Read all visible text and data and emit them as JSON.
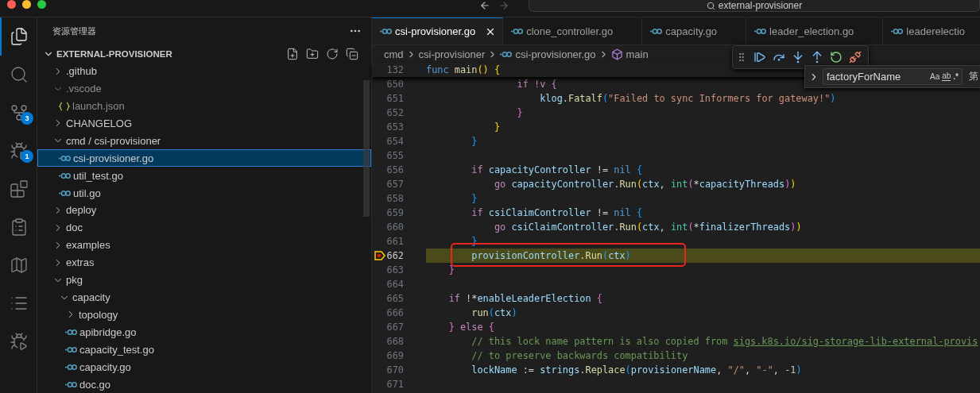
{
  "title_bar": {
    "nav": [
      {
        "kind": "back",
        "disabled": false
      },
      {
        "kind": "forward",
        "disabled": true
      }
    ],
    "search": "external-provisioner"
  },
  "activity_bar": [
    {
      "kind": "explorer",
      "selected": true
    },
    {
      "kind": "search",
      "selected": false
    },
    {
      "kind": "source-control",
      "selected": false,
      "badge": "3"
    },
    {
      "kind": "run-debug",
      "selected": false,
      "badge": "1"
    },
    {
      "kind": "extensions",
      "selected": false
    },
    {
      "kind": "clipboard",
      "selected": false
    },
    {
      "kind": "map",
      "selected": false
    },
    {
      "kind": "list",
      "selected": false
    },
    {
      "kind": "debug",
      "selected": false
    }
  ],
  "sidebar": {
    "title": "资源管理器",
    "tree": {
      "label": "EXTERNAL-PROVISIONER",
      "expanded": true,
      "children": [
        {
          "label": ".github",
          "kind": "folder",
          "expanded": false,
          "dimmed": false,
          "selected": false
        },
        {
          "label": ".vscode",
          "kind": "folder",
          "expanded": true,
          "dimmed": true,
          "selected": false,
          "children": [
            {
              "label": "launch.json",
              "kind": "json",
              "dimmed": true,
              "selected": false
            }
          ]
        },
        {
          "label": "CHANGELOG",
          "kind": "folder",
          "expanded": false,
          "dimmed": false,
          "selected": false
        },
        {
          "label": "cmd / csi-provisioner",
          "kind": "folder",
          "expanded": true,
          "dimmed": false,
          "selected": false,
          "children": [
            {
              "label": "csi-provisioner.go",
              "kind": "go",
              "dimmed": false,
              "selected": true
            },
            {
              "label": "util_test.go",
              "kind": "go",
              "dimmed": false,
              "selected": false
            },
            {
              "label": "util.go",
              "kind": "go",
              "dimmed": false,
              "selected": false
            }
          ]
        },
        {
          "label": "deploy",
          "kind": "folder",
          "expanded": false,
          "dimmed": false,
          "selected": false
        },
        {
          "label": "doc",
          "kind": "folder",
          "expanded": false,
          "dimmed": false,
          "selected": false
        },
        {
          "label": "examples",
          "kind": "folder",
          "expanded": false,
          "dimmed": false,
          "selected": false
        },
        {
          "label": "extras",
          "kind": "folder",
          "expanded": false,
          "dimmed": false,
          "selected": false
        },
        {
          "label": "pkg",
          "kind": "folder",
          "expanded": true,
          "dimmed": false,
          "selected": false,
          "children": [
            {
              "label": "capacity",
              "kind": "folder",
              "expanded": true,
              "dimmed": false,
              "selected": false,
              "children": [
                {
                  "label": "topology",
                  "kind": "folder",
                  "expanded": false,
                  "dimmed": false,
                  "selected": false
                },
                {
                  "label": "apibridge.go",
                  "kind": "go",
                  "dimmed": false,
                  "selected": false
                },
                {
                  "label": "capacity_test.go",
                  "kind": "go",
                  "dimmed": false,
                  "selected": false
                },
                {
                  "label": "capacity.go",
                  "kind": "go",
                  "dimmed": false,
                  "selected": false
                },
                {
                  "label": "doc.go",
                  "kind": "go",
                  "dimmed": false,
                  "selected": false
                }
              ]
            }
          ]
        }
      ]
    }
  },
  "tabs": [
    {
      "label": "csi-provisioner.go",
      "selected": true
    },
    {
      "label": "clone_controller.go",
      "selected": false
    },
    {
      "label": "capacity.go",
      "selected": false
    },
    {
      "label": "leader_election.go",
      "selected": false
    },
    {
      "label": "leaderelectio",
      "selected": false
    }
  ],
  "breadcrumb": [
    {
      "label": "cmd",
      "kind": "folder"
    },
    {
      "label": "csi-provisioner",
      "kind": "folder"
    },
    {
      "label": "csi-provisioner.go",
      "kind": "go"
    },
    {
      "label": "main",
      "kind": "function"
    }
  ],
  "debug_toolbar": [
    {
      "kind": "continue"
    },
    {
      "kind": "step-over"
    },
    {
      "kind": "step-into"
    },
    {
      "kind": "step-out"
    },
    {
      "kind": "restart"
    },
    {
      "kind": "disconnect"
    }
  ],
  "find_widget": {
    "value": "factoryForName",
    "options": [
      {
        "label": "Aa",
        "kind": "case"
      },
      {
        "label": "ab",
        "kind": "word"
      },
      {
        "label": ".*",
        "kind": "regex"
      }
    ],
    "status": "第"
  },
  "sticky_line": {
    "number": "132",
    "tokens": [
      {
        "text": "func",
        "kind": "decl"
      },
      {
        "text": " main",
        "kind": "fn"
      },
      {
        "text": "()",
        "kind": "b1"
      },
      {
        "text": " {",
        "kind": "b1"
      }
    ]
  },
  "lines": [
    {
      "number": "650",
      "current": false,
      "boxed": false,
      "tokens": [
        {
          "text": "                if !v {",
          "kind": "kw"
        }
      ]
    },
    {
      "number": "651",
      "current": false,
      "boxed": false,
      "tokens": [
        {
          "text": "                    klog",
          "kind": "var"
        },
        {
          "text": ".",
          "kind": "op"
        },
        {
          "text": "Fatalf",
          "kind": "fn"
        },
        {
          "text": "(",
          "kind": "b3"
        },
        {
          "text": "\"Failed to sync Informers for gateway!\"",
          "kind": "str"
        },
        {
          "text": ")",
          "kind": "b3"
        }
      ]
    },
    {
      "number": "652",
      "current": false,
      "boxed": false,
      "tokens": [
        {
          "text": "                }",
          "kind": "b2"
        }
      ]
    },
    {
      "number": "653",
      "current": false,
      "boxed": false,
      "tokens": [
        {
          "text": "            }",
          "kind": "b1"
        }
      ]
    },
    {
      "number": "654",
      "current": false,
      "boxed": false,
      "tokens": [
        {
          "text": "        }",
          "kind": "b3"
        }
      ]
    },
    {
      "number": "655",
      "current": false,
      "boxed": false
    },
    {
      "number": "656",
      "current": false,
      "boxed": false,
      "tokens": [
        {
          "text": "        if",
          "kind": "kw"
        },
        {
          "text": " capacityController",
          "kind": "var"
        },
        {
          "text": " != ",
          "kind": "op"
        },
        {
          "text": "nil",
          "kind": "const"
        },
        {
          "text": " {",
          "kind": "b3"
        }
      ]
    },
    {
      "number": "657",
      "current": false,
      "boxed": false,
      "tokens": [
        {
          "text": "            go",
          "kind": "kw"
        },
        {
          "text": " capacityController",
          "kind": "var"
        },
        {
          "text": ".",
          "kind": "op"
        },
        {
          "text": "Run",
          "kind": "fn"
        },
        {
          "text": "(",
          "kind": "b1"
        },
        {
          "text": "ctx",
          "kind": "var"
        },
        {
          "text": ", ",
          "kind": "op"
        },
        {
          "text": "int",
          "kind": "type"
        },
        {
          "text": "(",
          "kind": "b2"
        },
        {
          "text": "*",
          "kind": "op"
        },
        {
          "text": "capacityThreads",
          "kind": "var"
        },
        {
          "text": ")",
          "kind": "b2"
        },
        {
          "text": ")",
          "kind": "b1"
        }
      ]
    },
    {
      "number": "658",
      "current": false,
      "boxed": false,
      "tokens": [
        {
          "text": "        }",
          "kind": "b3"
        }
      ]
    },
    {
      "number": "659",
      "current": false,
      "boxed": false,
      "tokens": [
        {
          "text": "        if",
          "kind": "kw"
        },
        {
          "text": " csiClaimController",
          "kind": "var"
        },
        {
          "text": " != ",
          "kind": "op"
        },
        {
          "text": "nil",
          "kind": "const"
        },
        {
          "text": " {",
          "kind": "b3"
        }
      ]
    },
    {
      "number": "660",
      "current": false,
      "boxed": false,
      "tokens": [
        {
          "text": "            go",
          "kind": "kw"
        },
        {
          "text": " csiClaimController",
          "kind": "var"
        },
        {
          "text": ".",
          "kind": "op"
        },
        {
          "text": "Run",
          "kind": "fn"
        },
        {
          "text": "(",
          "kind": "b1"
        },
        {
          "text": "ctx",
          "kind": "var"
        },
        {
          "text": ", ",
          "kind": "op"
        },
        {
          "text": "int",
          "kind": "type"
        },
        {
          "text": "(",
          "kind": "b2"
        },
        {
          "text": "*",
          "kind": "op"
        },
        {
          "text": "finalizerThreads",
          "kind": "var"
        },
        {
          "text": ")",
          "kind": "b2"
        },
        {
          "text": ")",
          "kind": "b1"
        }
      ]
    },
    {
      "number": "661",
      "current": false,
      "boxed": false,
      "tokens": [
        {
          "text": "        }",
          "kind": "b3"
        }
      ]
    },
    {
      "number": "662",
      "current": true,
      "boxed": true,
      "tokens": [
        {
          "text": "        provisionController",
          "kind": "var"
        },
        {
          "text": ".",
          "kind": "op"
        },
        {
          "text": "Run",
          "kind": "fn"
        },
        {
          "text": "(",
          "kind": "b3"
        },
        {
          "text": "ctx",
          "kind": "var"
        },
        {
          "text": ")",
          "kind": "b3"
        }
      ]
    },
    {
      "number": "663",
      "current": false,
      "boxed": false,
      "tokens": [
        {
          "text": "    }",
          "kind": "b2"
        }
      ]
    },
    {
      "number": "664",
      "current": false,
      "boxed": false
    },
    {
      "number": "665",
      "current": false,
      "boxed": false,
      "tokens": [
        {
          "text": "    if",
          "kind": "kw"
        },
        {
          "text": " !*",
          "kind": "op"
        },
        {
          "text": "enableLeaderElection",
          "kind": "var"
        },
        {
          "text": " {",
          "kind": "b2"
        }
      ]
    },
    {
      "number": "666",
      "current": false,
      "boxed": false,
      "tokens": [
        {
          "text": "        run",
          "kind": "fn"
        },
        {
          "text": "(",
          "kind": "b3"
        },
        {
          "text": "ctx",
          "kind": "var"
        },
        {
          "text": ")",
          "kind": "b3"
        }
      ]
    },
    {
      "number": "667",
      "current": false,
      "boxed": false,
      "tokens": [
        {
          "text": "    }",
          "kind": "b2"
        },
        {
          "text": " else ",
          "kind": "kw"
        },
        {
          "text": "{",
          "kind": "b2"
        }
      ]
    },
    {
      "number": "668",
      "current": false,
      "boxed": false,
      "tokens": [
        {
          "text": "        // this lock name pattern is also copied from ",
          "kind": "comment"
        },
        {
          "text": "sigs.k8s.io/sig-storage-lib-external-provis",
          "kind": "link"
        }
      ]
    },
    {
      "number": "669",
      "current": false,
      "boxed": false,
      "tokens": [
        {
          "text": "        // to preserve backwards compatibility",
          "kind": "comment"
        }
      ]
    },
    {
      "number": "670",
      "current": false,
      "boxed": false,
      "tokens": [
        {
          "text": "        lockName",
          "kind": "var"
        },
        {
          "text": " := ",
          "kind": "op"
        },
        {
          "text": "strings",
          "kind": "var"
        },
        {
          "text": ".",
          "kind": "op"
        },
        {
          "text": "Replace",
          "kind": "fn"
        },
        {
          "text": "(",
          "kind": "b3"
        },
        {
          "text": "provisionerName",
          "kind": "var"
        },
        {
          "text": ", ",
          "kind": "op"
        },
        {
          "text": "\"/\"",
          "kind": "str"
        },
        {
          "text": ", ",
          "kind": "op"
        },
        {
          "text": "\"-\"",
          "kind": "str"
        },
        {
          "text": ", ",
          "kind": "op"
        },
        {
          "text": "-1",
          "kind": "num"
        },
        {
          "text": ")",
          "kind": "b3"
        }
      ]
    },
    {
      "number": "671",
      "current": false,
      "boxed": false
    }
  ]
}
